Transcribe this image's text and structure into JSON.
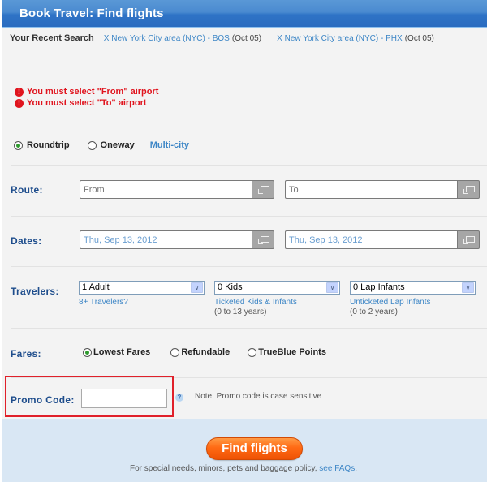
{
  "header": {
    "title": "Book Travel: Find flights"
  },
  "recent_search": {
    "label": "Your Recent Search",
    "items": [
      {
        "link": "X New York City area (NYC) - BOS",
        "date": "(Oct 05)"
      },
      {
        "link": "X New York City area (NYC) - PHX",
        "date": "(Oct 05)"
      }
    ]
  },
  "errors": [
    {
      "icon": "exclamation-icon",
      "glyph": "!",
      "text": "You must select \"From\" airport"
    },
    {
      "icon": "exclamation-icon",
      "glyph": "!",
      "text": "You must select \"To\" airport"
    }
  ],
  "trip_type": {
    "options": [
      {
        "label": "Roundtrip",
        "checked": true
      },
      {
        "label": "Oneway",
        "checked": false
      }
    ],
    "multi_city": "Multi-city"
  },
  "route": {
    "label": "Route:",
    "from": {
      "value": "",
      "placeholder": "From"
    },
    "to": {
      "value": "",
      "placeholder": "To"
    }
  },
  "dates": {
    "label": "Dates:",
    "depart": "Thu, Sep 13, 2012",
    "return": "Thu, Sep 13, 2012"
  },
  "travelers": {
    "label": "Travelers:",
    "adults": {
      "selected": "1 Adult",
      "link": "8+ Travelers?"
    },
    "kids": {
      "selected": "0 Kids",
      "link": "Ticketed Kids & Infants",
      "note": "(0 to 13 years)"
    },
    "infants": {
      "selected": "0 Lap Infants",
      "link": "Unticketed Lap Infants",
      "note": "(0 to 2 years)"
    },
    "arrow_glyph": "∨"
  },
  "fares": {
    "label": "Fares:",
    "options": [
      {
        "label": "Lowest Fares",
        "checked": true
      },
      {
        "label": "Refundable",
        "checked": false
      },
      {
        "label": "TrueBlue Points",
        "checked": false
      }
    ]
  },
  "promo": {
    "label": "Promo Code:",
    "value": "",
    "help_glyph": "?",
    "note": "Note: Promo code is case sensitive"
  },
  "footer": {
    "button": "Find flights",
    "note_prefix": "For special needs, minors, pets and baggage policy, ",
    "note_link": "see FAQs",
    "note_suffix": "."
  },
  "colors": {
    "header_blue": "#2f73c6",
    "link_blue": "#3d86c6",
    "label_navy": "#1e4d8c",
    "error_red": "#e0141e",
    "button_orange": "#ff6a14",
    "footer_bg": "#d9e7f4"
  }
}
